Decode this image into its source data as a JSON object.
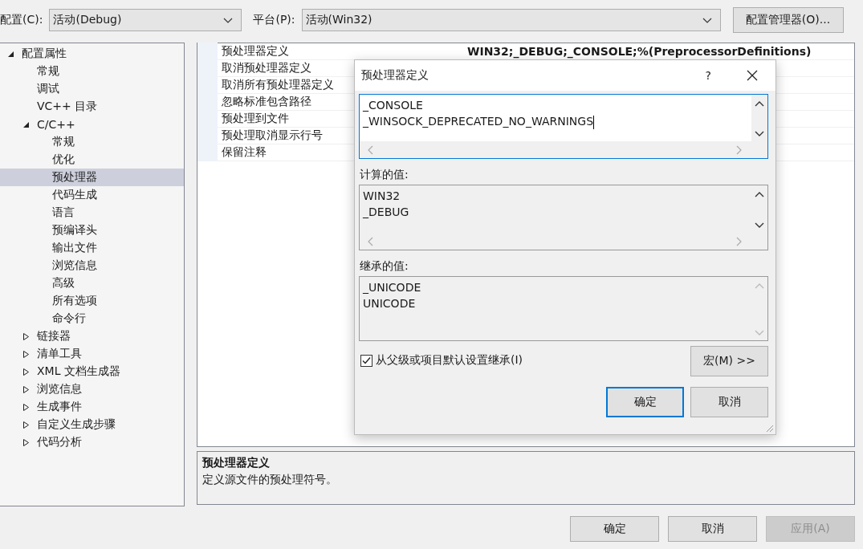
{
  "toolbar": {
    "config_label": "配置(C):",
    "config_value": "活动(Debug)",
    "platform_label": "平台(P):",
    "platform_value": "活动(Win32)",
    "manager_button": "配置管理器(O)..."
  },
  "tree": [
    {
      "label": "配置属性",
      "expanded": true,
      "selected": false,
      "children": [
        {
          "label": "常规",
          "selected": false
        },
        {
          "label": "调试",
          "selected": false
        },
        {
          "label": "VC++ 目录",
          "selected": false
        },
        {
          "label": "C/C++",
          "expanded": true,
          "selected": false,
          "children": [
            {
              "label": "常规",
              "selected": false
            },
            {
              "label": "优化",
              "selected": false
            },
            {
              "label": "预处理器",
              "selected": true
            },
            {
              "label": "代码生成",
              "selected": false
            },
            {
              "label": "语言",
              "selected": false
            },
            {
              "label": "预编译头",
              "selected": false
            },
            {
              "label": "输出文件",
              "selected": false
            },
            {
              "label": "浏览信息",
              "selected": false
            },
            {
              "label": "高级",
              "selected": false
            },
            {
              "label": "所有选项",
              "selected": false
            },
            {
              "label": "命令行",
              "selected": false
            }
          ]
        },
        {
          "label": "链接器",
          "expanded": false,
          "selected": false
        },
        {
          "label": "清单工具",
          "expanded": false,
          "selected": false
        },
        {
          "label": "XML 文档生成器",
          "expanded": false,
          "selected": false
        },
        {
          "label": "浏览信息",
          "expanded": false,
          "selected": false
        },
        {
          "label": "生成事件",
          "expanded": false,
          "selected": false
        },
        {
          "label": "自定义生成步骤",
          "expanded": false,
          "selected": false
        },
        {
          "label": "代码分析",
          "expanded": false,
          "selected": false
        }
      ]
    }
  ],
  "properties": [
    {
      "name": "预处理器定义",
      "value": "WIN32;_DEBUG;_CONSOLE;%(PreprocessorDefinitions)"
    },
    {
      "name": "取消预处理器定义"
    },
    {
      "name": "取消所有预处理器定义"
    },
    {
      "name": "忽略标准包含路径"
    },
    {
      "name": "预处理到文件"
    },
    {
      "name": "预处理取消显示行号"
    },
    {
      "name": "保留注释"
    }
  ],
  "description": {
    "title": "预处理器定义",
    "text": "定义源文件的预处理符号。"
  },
  "buttons": [
    {
      "label": "确定",
      "disabled": false
    },
    {
      "label": "取消",
      "disabled": false
    },
    {
      "label": "应用(A)",
      "disabled": true
    }
  ],
  "dialog": {
    "title": "预处理器定义",
    "help": "?",
    "edit_lines": [
      "_CONSOLE",
      "_WINSOCK_DEPRECATED_NO_WARNINGS"
    ],
    "computed_label": "计算的值:",
    "computed_lines": [
      "WIN32",
      "_DEBUG"
    ],
    "inherited_label": "继承的值:",
    "inherited_lines": [
      "_UNICODE",
      "UNICODE"
    ],
    "inherit_checkbox": {
      "label": "从父级或项目默认设置继承(I)",
      "checked": true
    },
    "macro_button": "宏(M) >>",
    "buttons": [
      {
        "label": "确定",
        "default": true
      },
      {
        "label": "取消",
        "default": false
      }
    ]
  }
}
